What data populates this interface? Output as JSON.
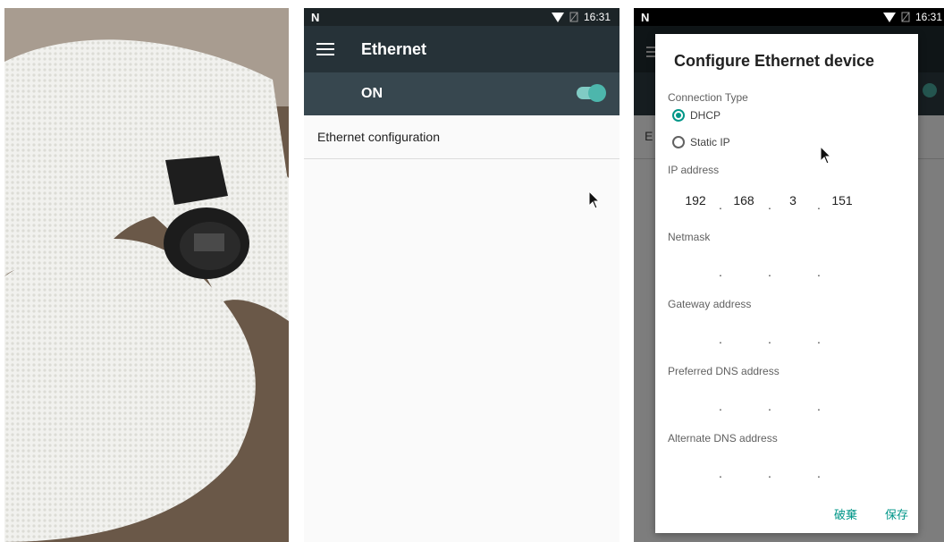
{
  "status": {
    "time": "16:31"
  },
  "ethernet_screen": {
    "title": "Ethernet",
    "switch_label": "ON",
    "switch_on": true,
    "config_item": "Ethernet configuration"
  },
  "dialog": {
    "background_row_initial": "E",
    "title": "Configure Ethernet device",
    "connection_type_label": "Connection Type",
    "options": [
      {
        "label": "DHCP",
        "selected": true
      },
      {
        "label": "Static IP",
        "selected": false
      }
    ],
    "ip_address": {
      "label": "IP address",
      "octets": [
        "192",
        "168",
        "3",
        "151"
      ]
    },
    "netmask": {
      "label": "Netmask",
      "octets": [
        "",
        "",
        "",
        ""
      ]
    },
    "gateway": {
      "label": "Gateway address",
      "octets": [
        "",
        "",
        "",
        ""
      ]
    },
    "preferred_dns": {
      "label": "Preferred DNS address",
      "octets": [
        "",
        "",
        "",
        ""
      ]
    },
    "alternate_dns": {
      "label": "Alternate DNS address",
      "octets": [
        "",
        "",
        "",
        ""
      ]
    },
    "buttons": {
      "discard": "破棄",
      "save": "保存"
    }
  },
  "colors": {
    "accent": "#009688",
    "appbar": "#263238",
    "switchbar": "#37474f",
    "toggle_knob": "#4db6ac"
  }
}
